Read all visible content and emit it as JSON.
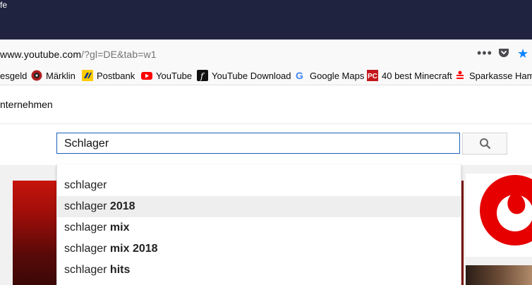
{
  "window": {
    "title_fragment": "fe"
  },
  "address_bar": {
    "url_prefix": "",
    "url_host": "www.youtube.com",
    "url_rest": "/?gl=DE&tab=w1",
    "more_icon": "more-dots-icon",
    "pocket_icon": "pocket-icon",
    "star_icon": "star-icon"
  },
  "bookmarks": [
    {
      "label": "esgeld",
      "icon": ""
    },
    {
      "label": "Märklin",
      "icon": "marklin-icon"
    },
    {
      "label": "Postbank",
      "icon": "postbank-icon"
    },
    {
      "label": "YouTube",
      "icon": "youtube-icon"
    },
    {
      "label": "YouTube Download",
      "icon": "f-icon"
    },
    {
      "label": "Google Maps",
      "icon": "google-icon"
    },
    {
      "label": "40 best Minecraft",
      "icon": "pc-icon"
    },
    {
      "label": "Sparkasse Hameln",
      "icon": "sparkasse-icon"
    }
  ],
  "yt_header": {
    "nav_label": "nternehmen"
  },
  "search": {
    "value": "Schlager",
    "button_icon": "search-icon"
  },
  "suggestions": [
    {
      "prefix": "schlager",
      "suffix": ""
    },
    {
      "prefix": "schlager ",
      "suffix": "2018"
    },
    {
      "prefix": "schlager ",
      "suffix": "mix"
    },
    {
      "prefix": "schlager ",
      "suffix": "mix 2018"
    },
    {
      "prefix": "schlager ",
      "suffix": "hits"
    }
  ],
  "colors": {
    "titlebar": "#202340",
    "accent_blue": "#0a84ff",
    "youtube_red": "#ff0000",
    "vodafone_red": "#e60000"
  }
}
